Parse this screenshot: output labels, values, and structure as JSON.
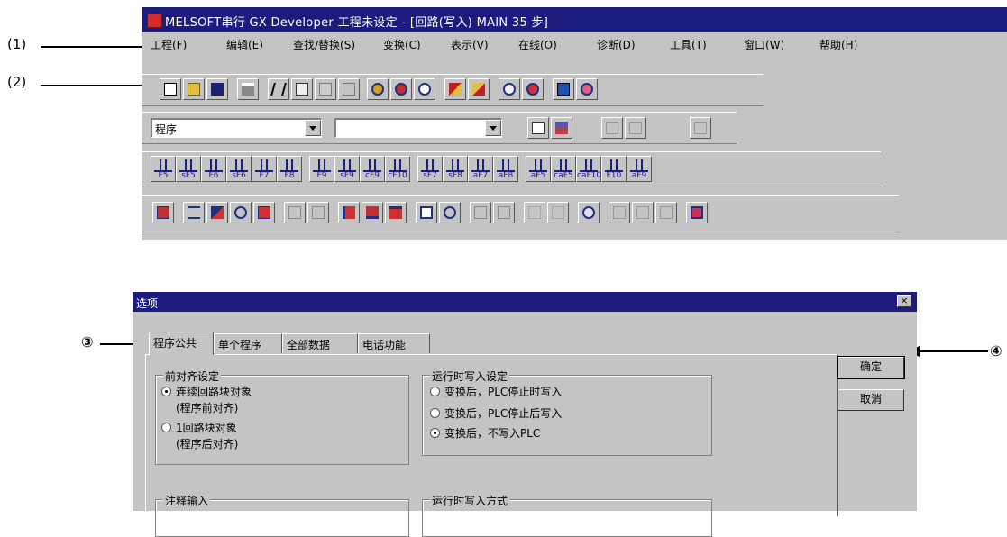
{
  "annotations": {
    "a1": "(1)",
    "a2": "(2)",
    "a3": "③",
    "a4": "④"
  },
  "window": {
    "title": "MELSOFT串行 GX Developer 工程未设定 - [回路(写入)     MAIN    35 步]"
  },
  "menu": [
    "工程(F)",
    "编辑(E)",
    "查找/替换(S)",
    "变换(C)",
    "表示(V)",
    "在线(O)",
    "诊断(D)",
    "工具(T)",
    "窗口(W)",
    "帮助(H)"
  ],
  "toolbar": {
    "combo1_value": "程序",
    "combo2_value": ""
  },
  "ladder_keys": [
    "F5",
    "sF5",
    "F6",
    "sF6",
    "F7",
    "F8",
    "F9",
    "sF9",
    "cF9",
    "cF10",
    "sF7",
    "sF8",
    "aF7",
    "aF8",
    "aF5",
    "caF5",
    "caF10",
    "F10",
    "aF9"
  ],
  "dialog": {
    "title": "选项",
    "close_label": "×",
    "tabs": [
      "程序公共",
      "单个程序",
      "全部数据",
      "电话功能"
    ],
    "ok_label": "确定",
    "cancel_label": "取消",
    "group1": {
      "label": "前对齐设定",
      "options": [
        {
          "l1": "连续回路块对象",
          "l2": "(程序前对齐)",
          "selected": true
        },
        {
          "l1": "1回路块对象",
          "l2": "(程序后对齐)",
          "selected": false
        }
      ]
    },
    "group2": {
      "label": "运行时写入设定",
      "options": [
        {
          "l1": "变换后，PLC停止时写入",
          "selected": false
        },
        {
          "l1": "变换后，PLC停止后写入",
          "selected": false
        },
        {
          "l1": "变换后，不写入PLC",
          "selected": true
        }
      ]
    },
    "group3_label": "注释输入",
    "group4_label": "运行时写入方式"
  },
  "colors": {
    "titlebar": "#1c1c7e",
    "face": "#c4c4c4",
    "icon_accent": "#1b1b80"
  }
}
